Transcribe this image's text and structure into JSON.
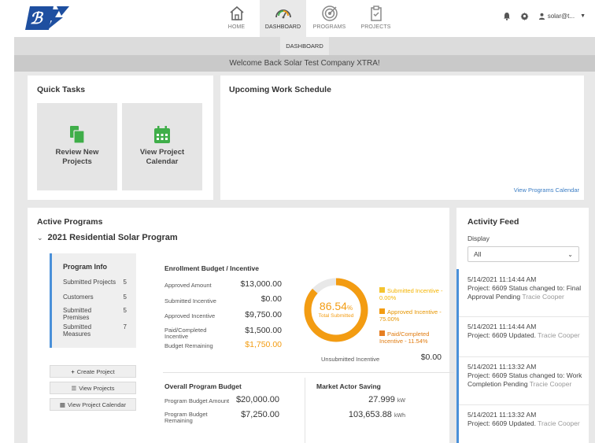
{
  "header": {
    "nav": [
      {
        "label": "HOME",
        "icon": "home-icon"
      },
      {
        "label": "DASHBOARD",
        "icon": "dashboard-gauge-icon"
      },
      {
        "label": "PROGRAMS",
        "icon": "target-icon"
      },
      {
        "label": "PROJECTS",
        "icon": "clipboard-icon"
      }
    ],
    "user": "solar@t...",
    "subtab": "DASHBOARD",
    "welcome": "Welcome Back Solar Test Company XTRA!"
  },
  "quick_tasks": {
    "title": "Quick Tasks",
    "tiles": [
      {
        "label1": "Review New",
        "label2": "Projects"
      },
      {
        "label1": "View Project",
        "label2": "Calendar"
      }
    ]
  },
  "schedule": {
    "title": "Upcoming Work Schedule",
    "link": "View Programs Calendar"
  },
  "programs": {
    "title": "Active Programs",
    "program_name": "2021 Residential Solar Program",
    "info": {
      "title": "Program Info",
      "rows": [
        {
          "label": "Submitted Projects",
          "value": "5"
        },
        {
          "label": "Customers",
          "value": "5"
        },
        {
          "label": "Submitted Premises",
          "value": "5"
        },
        {
          "label": "Submitted Measures",
          "value": "7"
        }
      ]
    },
    "buttons": {
      "create": "Create Project",
      "view": "View Projects",
      "calendar": "View Project Calendar"
    },
    "enrollment": {
      "title": "Enrollment Budget / Incentive",
      "rows": [
        {
          "label": "Approved Amount",
          "value": "$13,000.00"
        },
        {
          "label": "Submitted Incentive",
          "value": "$0.00"
        },
        {
          "label": "Approved Incentive",
          "value": "$9,750.00"
        },
        {
          "label": "Paid/Completed Incentive",
          "value": "$1,500.00"
        },
        {
          "label": "Budget Remaining",
          "value": "$1,750.00"
        }
      ]
    },
    "donut": {
      "value": "86.54",
      "unit": "%",
      "label": "Total Submitted",
      "fraction": 0.8654
    },
    "legend": [
      {
        "text": "Submitted Incentive - 0.00%",
        "color": "#f4c430"
      },
      {
        "text": "Approved Incentive - 75.00%",
        "color": "#f39c12"
      },
      {
        "text": "Paid/Completed Incentive - 11.54%",
        "color": "#e67e22"
      }
    ],
    "unsubmitted": {
      "label": "Unsubmitted Incentive",
      "value": "$0.00"
    },
    "overall": {
      "title": "Overall Program Budget",
      "rows": [
        {
          "label": "Program Budget Amount",
          "value": "$20,000.00"
        },
        {
          "label": "Program Budget Remaining",
          "value": "$7,250.00"
        }
      ]
    },
    "market": {
      "title": "Market Actor Saving",
      "rows": [
        {
          "value": "27.999",
          "unit": "kW"
        },
        {
          "value": "103,653.88",
          "unit": "kWh"
        }
      ]
    }
  },
  "feed": {
    "title": "Activity Feed",
    "display_label": "Display",
    "display_value": "All",
    "items": [
      {
        "time": "5/14/2021 11:14:44 AM",
        "text": "Project: 6609 Status changed to: Final Approval Pending",
        "who": "Tracie Cooper"
      },
      {
        "time": "5/14/2021 11:14:44 AM",
        "text": "Project: 6609 Updated.",
        "who": "Tracie Cooper"
      },
      {
        "time": "5/14/2021 11:13:32 AM",
        "text": "Project: 6609 Status changed to: Work Completion Pending",
        "who": "Tracie Cooper"
      },
      {
        "time": "5/14/2021 11:13:32 AM",
        "text": "Project: 6609 Updated.",
        "who": "Tracie Cooper"
      }
    ]
  },
  "colors": {
    "accent": "#f39c12",
    "link": "#3b7dc4",
    "green": "#3fae49",
    "brand_blue": "#1e4fa0"
  }
}
